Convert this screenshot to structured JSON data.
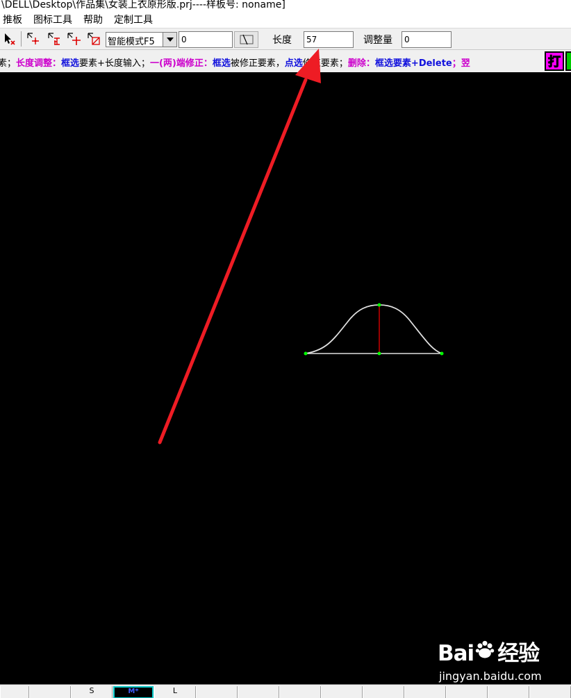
{
  "window": {
    "title": "\\DELL\\Desktop\\作品集\\女装上衣原形版.prj----样板号: noname]"
  },
  "menu": {
    "items": [
      "推板",
      "图标工具",
      "帮助",
      "定制工具"
    ]
  },
  "toolbar": {
    "mode_select": "智能模式F5",
    "value_field": "0",
    "length_label": "长度",
    "length_value": "57",
    "adjust_label": "调整量",
    "adjust_value": "0",
    "icons": [
      "select-cancel-icon",
      "move-point-icon",
      "correct-icon",
      "add-point-icon",
      "delete-icon"
    ]
  },
  "hint": {
    "s1": "素；",
    "s2": "长度调整：",
    "s3": "框选",
    "s4": "要素+长度输入；",
    "s5": "一(两)端修正：",
    "s6": "框选",
    "s7": "被修正要素，",
    "s8": "点选",
    "s9": "修正要素；",
    "s10": "删除：",
    "s11": "框选要素+Delete",
    "s12": "；翌",
    "print_label": "打"
  },
  "canvas": {
    "curve_color": "#e0e0e0",
    "centerline_color": "#cc0000",
    "point_color": "#00ff00",
    "arrow_color": "#ee1c24"
  },
  "watermark": {
    "brand_left": "Bai",
    "brand_right": "经验",
    "url": "jingyan.baidu.com"
  },
  "status": {
    "sizes": [
      "",
      "",
      "S",
      "M*",
      "L",
      "",
      "",
      "",
      "",
      "",
      "",
      "",
      "",
      ""
    ]
  }
}
